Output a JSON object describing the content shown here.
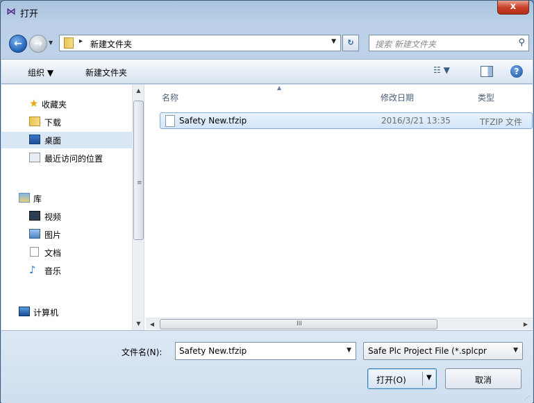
{
  "window": {
    "title": "打开",
    "app_icon": "visual-studio-icon",
    "close_label": "x"
  },
  "navigation": {
    "back_icon": "back-arrow-icon",
    "forward_icon": "forward-arrow-icon",
    "breadcrumb_separator": "▸",
    "breadcrumb_current": "新建文件夹",
    "search_placeholder": "搜索 新建文件夹"
  },
  "toolbar": {
    "organize_label": "组织 ▼",
    "new_folder_label": "新建文件夹"
  },
  "sidebar": {
    "items": [
      {
        "label": "收藏夹",
        "icon": "star-icon"
      },
      {
        "label": "下载",
        "icon": "download-folder-icon"
      },
      {
        "label": "桌面",
        "icon": "desktop-icon"
      },
      {
        "label": "最近访问的位置",
        "icon": "recent-places-icon"
      },
      {
        "label": "库",
        "icon": "library-icon"
      },
      {
        "label": "视频",
        "icon": "video-icon"
      },
      {
        "label": "图片",
        "icon": "picture-icon"
      },
      {
        "label": "文档",
        "icon": "document-icon"
      },
      {
        "label": "音乐",
        "icon": "music-icon"
      },
      {
        "label": "计算机",
        "icon": "computer-icon"
      }
    ]
  },
  "file_list": {
    "columns": [
      "名称",
      "修改日期",
      "类型"
    ],
    "rows": [
      {
        "name": "Safety New.tfzip",
        "modified": "2016/3/21 13:35",
        "type": "TFZIP 文件"
      }
    ]
  },
  "footer": {
    "filename_label": "文件名(N):",
    "filename_value": "Safety New.tfzip",
    "filter_value": "Safe Plc Project File (*.splcpr",
    "open_label": "打开(O)",
    "cancel_label": "取消"
  },
  "colors": {
    "selection": "#d9e6f4",
    "file_selection_border": "#84acdd",
    "close_button": "#c8412a"
  }
}
